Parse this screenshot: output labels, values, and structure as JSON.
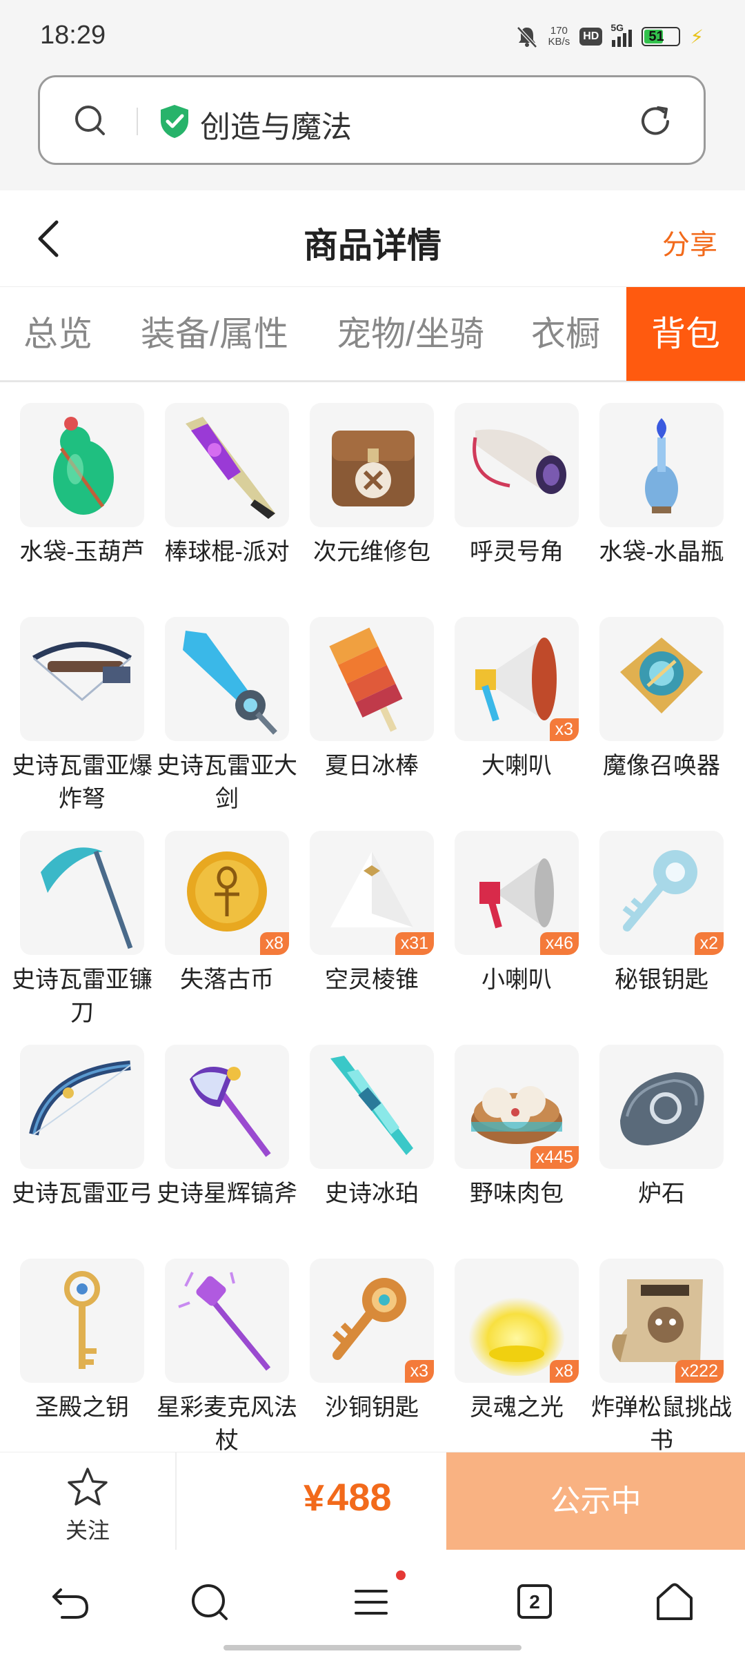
{
  "status_bar": {
    "time": "18:29",
    "net_speed": "170",
    "net_unit": "KB/s",
    "hd": "HD",
    "signal_label": "5G",
    "battery": "51",
    "icons": [
      "mute-bell-icon",
      "hd-icon",
      "signal-icon",
      "battery-icon",
      "charging-bolt-icon"
    ]
  },
  "address_bar": {
    "site_name": "创造与魔法",
    "icons": [
      "search-icon",
      "verified-shield-icon",
      "reload-icon"
    ]
  },
  "header": {
    "title": "商品详情",
    "share_label": "分享",
    "back_icon": "chevron-left-icon"
  },
  "tabs": [
    {
      "label": "总览",
      "active": false
    },
    {
      "label": "装备/属性",
      "active": false
    },
    {
      "label": "宠物/坐骑",
      "active": false
    },
    {
      "label": "衣橱",
      "active": false
    },
    {
      "label": "背包",
      "active": true
    }
  ],
  "items": [
    {
      "name": "水袋-玉葫芦",
      "qty": ""
    },
    {
      "name": "棒球棍-派对",
      "qty": ""
    },
    {
      "name": "次元维修包",
      "qty": ""
    },
    {
      "name": "呼灵号角",
      "qty": ""
    },
    {
      "name": "水袋-水晶瓶",
      "qty": ""
    },
    {
      "name": "史诗瓦雷亚爆炸弩",
      "qty": ""
    },
    {
      "name": "史诗瓦雷亚大剑",
      "qty": ""
    },
    {
      "name": "夏日冰棒",
      "qty": ""
    },
    {
      "name": "大喇叭",
      "qty": "x3"
    },
    {
      "name": "魔像召唤器",
      "qty": ""
    },
    {
      "name": "史诗瓦雷亚镰刀",
      "qty": ""
    },
    {
      "name": "失落古币",
      "qty": "x8"
    },
    {
      "name": "空灵棱锥",
      "qty": "x31"
    },
    {
      "name": "小喇叭",
      "qty": "x46"
    },
    {
      "name": "秘银钥匙",
      "qty": "x2"
    },
    {
      "name": "史诗瓦雷亚弓",
      "qty": ""
    },
    {
      "name": "史诗星辉镐斧",
      "qty": ""
    },
    {
      "name": "史诗冰珀",
      "qty": ""
    },
    {
      "name": "野味肉包",
      "qty": "x445"
    },
    {
      "name": "炉石",
      "qty": ""
    },
    {
      "name": "圣殿之钥",
      "qty": ""
    },
    {
      "name": "星彩麦克风法杖",
      "qty": ""
    },
    {
      "name": "沙铜钥匙",
      "qty": "x3"
    },
    {
      "name": "灵魂之光",
      "qty": "x8"
    },
    {
      "name": "炸弹松鼠挑战书",
      "qty": "x222"
    }
  ],
  "action_bar": {
    "follow_label": "关注",
    "currency": "¥",
    "price": "488",
    "status_label": "公示中"
  },
  "nav_bar": {
    "tab_count": "2",
    "icons": [
      "back-arrow-icon",
      "search-icon",
      "menu-icon",
      "tabs-icon",
      "home-icon"
    ]
  }
}
